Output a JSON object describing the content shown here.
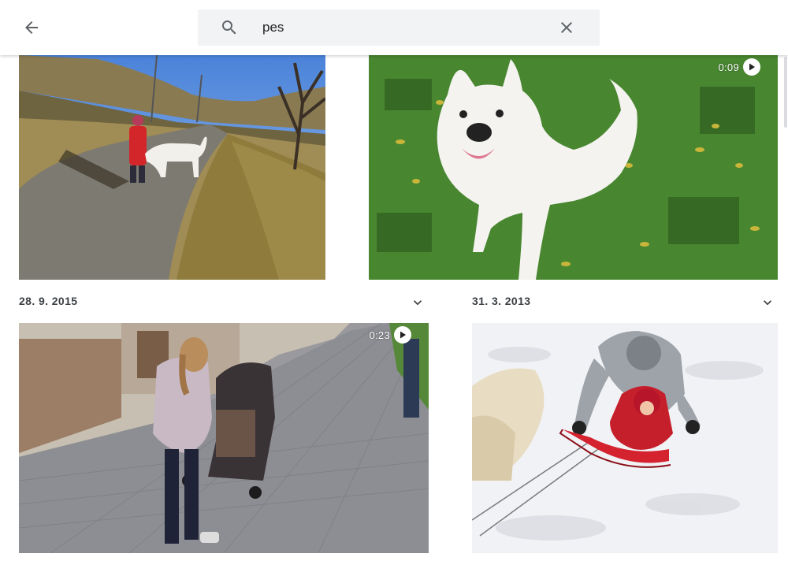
{
  "header": {
    "back_icon": "arrow-back-icon",
    "search_icon": "search-icon",
    "search_value": "pes",
    "clear_icon": "close-icon"
  },
  "groups": [
    {
      "date": "28. 9. 2015",
      "expand_icon": "chevron-down-icon"
    },
    {
      "date": "31. 3. 2013",
      "expand_icon": "chevron-down-icon"
    }
  ],
  "photos": [
    {
      "subject": "child walking with white dog on a country path",
      "is_video": false
    },
    {
      "subject": "white dog on grass with fallen leaves",
      "is_video": true,
      "duration": "0:09"
    },
    {
      "subject": "girl pushing a stroller on a paved sidewalk",
      "is_video": true,
      "duration": "0:23"
    },
    {
      "subject": "child on a red sled in the snow",
      "is_video": false
    }
  ],
  "colors": {
    "accent": "#5f6368",
    "search_bg": "#f1f3f4",
    "date_text": "#3c4043"
  }
}
